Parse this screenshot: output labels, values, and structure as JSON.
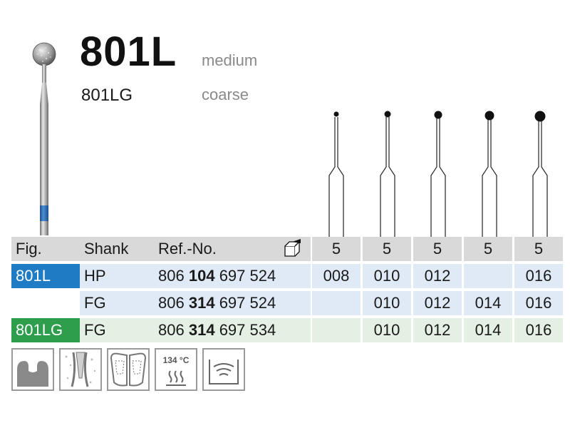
{
  "header": {
    "title": "801L",
    "subtitle": "801LG",
    "grit_primary": "medium",
    "grit_secondary": "coarse"
  },
  "table": {
    "headers": {
      "fig": "Fig.",
      "shank": "Shank",
      "ref": "Ref.-No.",
      "pack_icon": "package-icon",
      "pack_counts": [
        "5",
        "5",
        "5",
        "5",
        "5"
      ]
    },
    "rows": [
      {
        "fig": "801L",
        "shank": "HP",
        "ref_prefix": "806",
        "ref_bold": "104",
        "ref_suffix": "697 524",
        "sizes": [
          "008",
          "010",
          "012",
          "",
          "016"
        ]
      },
      {
        "fig": "",
        "shank": "FG",
        "ref_prefix": "806",
        "ref_bold": "314",
        "ref_suffix": "697 524",
        "sizes": [
          "",
          "010",
          "012",
          "014",
          "016"
        ]
      },
      {
        "fig": "801LG",
        "shank": "FG",
        "ref_prefix": "806",
        "ref_bold": "314",
        "ref_suffix": "697 534",
        "sizes": [
          "",
          "010",
          "012",
          "014",
          "016"
        ]
      }
    ]
  },
  "icons": [
    {
      "name": "crown-prep-icon"
    },
    {
      "name": "root-canal-icon"
    },
    {
      "name": "filling-removal-icon"
    },
    {
      "name": "sterilizable-icon",
      "label": "134 °C"
    },
    {
      "name": "ultrasonic-icon"
    }
  ],
  "colors": {
    "fig_blue": "#1e7bc4",
    "fig_green": "#2e9e4d",
    "row_blue": "#dfeaf6",
    "row_green": "#e4f0e4",
    "header_grey": "#d9d9d9",
    "bur_band": "#2a6db5"
  }
}
